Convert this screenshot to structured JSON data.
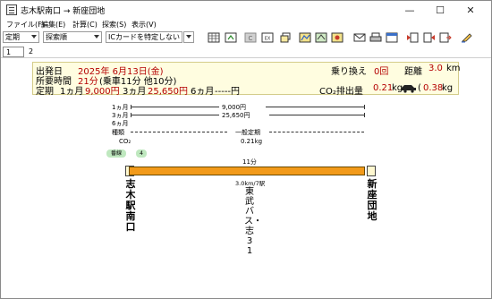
{
  "window": {
    "title": "志木駅南口 → 新座団地",
    "controls": {
      "minimize": "—",
      "maximize": "☐",
      "close": "✕"
    }
  },
  "menu": [
    {
      "label": "ファイル(F)"
    },
    {
      "label": "編集(E)"
    },
    {
      "label": "計算(C)"
    },
    {
      "label": "探索(S)"
    },
    {
      "label": "表示(V)"
    }
  ],
  "toolbar": {
    "fare_type": "定期",
    "sort": "探索順",
    "ic_card": "ICカードを特定しない",
    "icons": [
      "table-icon",
      "timetable-icon",
      "c-button-icon",
      "ex-button-icon",
      "copy-icon",
      "route-map-icon",
      "map-icon",
      "map-alt-icon",
      "mail-icon",
      "print-icon",
      "window-icon",
      "prev-route-icon",
      "next-route-icon",
      "export-icon",
      "edit-icon"
    ]
  },
  "tabs": [
    "1",
    "2"
  ],
  "summary": {
    "depart_label": "出発日",
    "depart_date": "2025年 6月13日(金)",
    "transfer_label": "乗り換え",
    "transfer_count": "0回",
    "distance_label": "距離",
    "distance_value": "3.0",
    "distance_unit": "km",
    "time_label": "所要時間",
    "time_total": "21分",
    "time_detail": "(乗車11分 他10分)",
    "pass_label": "定期",
    "m1_label": "1ヵ月",
    "m1_value": "9,000円",
    "m3_label": "3ヵ月",
    "m3_value": "25,650円",
    "m6_label": "6ヵ月",
    "m6_value": "-----円",
    "co2_label": "CO₂排出量",
    "co2_value": "0.21",
    "co2_unit": "kg",
    "car_icon": "car-icon",
    "car_value": "0.38",
    "car_unit": "kg"
  },
  "detail": {
    "rows": [
      {
        "label": "1ヵ月",
        "value": "9,000円"
      },
      {
        "label": "3ヵ月",
        "value": "25,650円"
      },
      {
        "label": "6ヵ月",
        "value": ""
      },
      {
        "label": "種類",
        "value": "一般定期"
      },
      {
        "label": "CO₂",
        "value": "0.21kg"
      }
    ]
  },
  "route": {
    "badge_line": "番線",
    "badge_platform": "4",
    "duration": "11分",
    "distance_stops": "3.0km/7駅",
    "from_station": "志木駅南口",
    "to_station": "新座団地",
    "line_name": "東武バス・志31"
  },
  "colors": {
    "route_bar": "#f29a1a",
    "highlight_red": "#b40000",
    "summary_bg": "#fffde0",
    "badge_green": "#bfe8bf"
  }
}
